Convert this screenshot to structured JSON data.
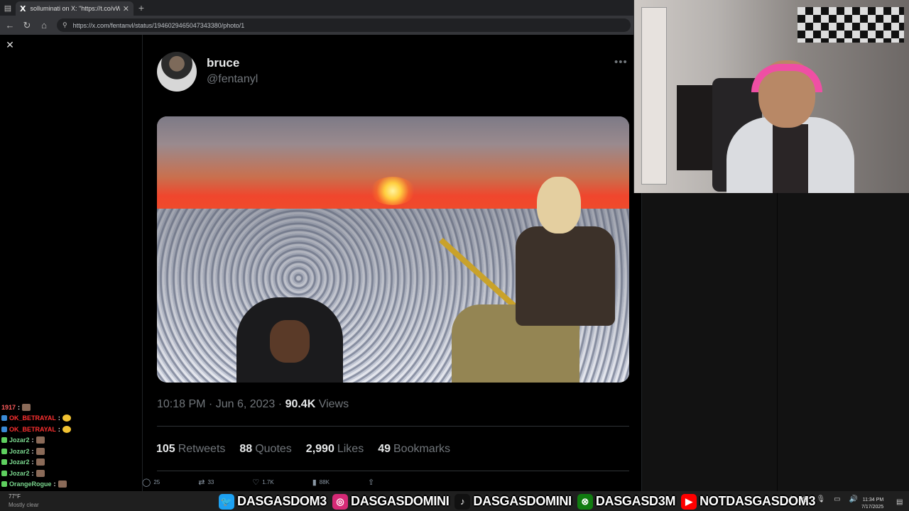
{
  "browser": {
    "tab_title": "solluminati on X: \"https://t.co/vW",
    "tab_logo": "X",
    "url": "https://x.com/fentanvl/status/1946029465047343380/photo/1"
  },
  "tweet": {
    "display_name": "bruce",
    "handle": "@fentanyl",
    "time": "10:18 PM · Jun 6, 2023 ·",
    "views_count": "90.4K",
    "views_label": "Views",
    "stats": [
      {
        "num": "105",
        "label": "Retweets"
      },
      {
        "num": "88",
        "label": "Quotes"
      },
      {
        "num": "2,990",
        "label": "Likes"
      },
      {
        "num": "49",
        "label": "Bookmarks"
      }
    ],
    "actions": [
      {
        "icon": "reply-icon",
        "glyph": "◯",
        "count": "25"
      },
      {
        "icon": "retweet-icon",
        "glyph": "⇄",
        "count": "33"
      },
      {
        "icon": "like-icon",
        "glyph": "♡",
        "count": "1.7K"
      },
      {
        "icon": "views-icon",
        "glyph": "▮",
        "count": "88K"
      },
      {
        "icon": "share-icon",
        "glyph": "⇪",
        "count": ""
      }
    ]
  },
  "chat": [
    {
      "user": "1917",
      "color": "#ff5c5c",
      "badge": "",
      "emote": "square"
    },
    {
      "user": "OK_BETRAYAL",
      "color": "#ff3030",
      "badge": "#3a8ad6",
      "emote": "round"
    },
    {
      "user": "OK_BETRAYAL",
      "color": "#ff3030",
      "badge": "#3a8ad6",
      "emote": "round"
    },
    {
      "user": "Jozar2",
      "color": "#7bd88f",
      "badge": "#5ecf5e",
      "emote": "square"
    },
    {
      "user": "Jozar2",
      "color": "#7bd88f",
      "badge": "#5ecf5e",
      "emote": "square"
    },
    {
      "user": "Jozar2",
      "color": "#7bd88f",
      "badge": "#5ecf5e",
      "emote": "square"
    },
    {
      "user": "Jozar2",
      "color": "#7bd88f",
      "badge": "#5ecf5e",
      "emote": "square"
    },
    {
      "user": "OrangeRogue",
      "color": "#7bd88f",
      "badge": "#5ecf5e",
      "emote": "square"
    },
    {
      "user": "OrangeRogue",
      "color": "#7bd88f",
      "badge": "#5ecf5e",
      "emote": "square"
    }
  ],
  "weather": {
    "temp": "77°F",
    "condition": "Mostly clear"
  },
  "socials": [
    {
      "icon": "twitter-icon",
      "glyph": "🐦",
      "bg": "#1da1f2",
      "handle": "DASGASDOM3"
    },
    {
      "icon": "instagram-icon",
      "glyph": "◎",
      "bg": "#d62976",
      "handle": "DASGASDOMINI"
    },
    {
      "icon": "tiktok-icon",
      "glyph": "♪",
      "bg": "#111111",
      "handle": "DASGASDOMINI"
    },
    {
      "icon": "xbox-icon",
      "glyph": "⊗",
      "bg": "#107c10",
      "handle": "DASGASD3M"
    },
    {
      "icon": "youtube-icon",
      "glyph": "▶",
      "bg": "#ff0000",
      "handle": "NOTDASGASDOM3"
    }
  ],
  "clock": {
    "time": "11:34 PM",
    "date": "7/17/2025"
  }
}
